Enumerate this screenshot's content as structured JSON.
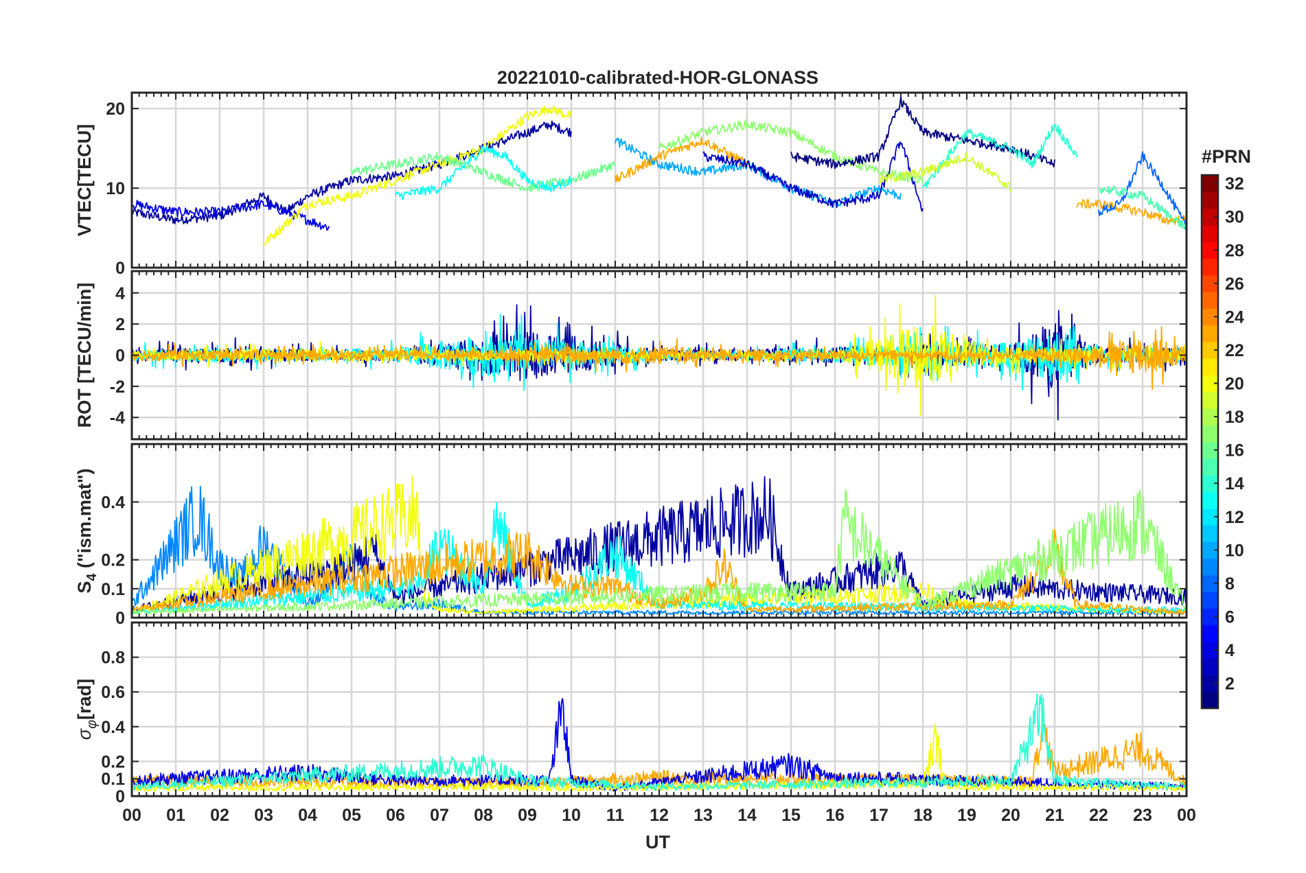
{
  "chart_data": {
    "type": "line",
    "title": "20221010-calibrated-HOR-GLONASS",
    "xlabel": "UT",
    "x_ticks": [
      "00",
      "01",
      "02",
      "03",
      "04",
      "05",
      "06",
      "07",
      "08",
      "09",
      "10",
      "11",
      "12",
      "13",
      "14",
      "15",
      "16",
      "17",
      "18",
      "19",
      "20",
      "21",
      "22",
      "23",
      "00"
    ],
    "xlim": [
      0,
      24
    ],
    "colorbar": {
      "label": "#PRN",
      "range": [
        1,
        32
      ],
      "ticks": [
        "32",
        "30",
        "28",
        "26",
        "24",
        "22",
        "20",
        "18",
        "16",
        "14",
        "12",
        "10",
        "8",
        "6",
        "4",
        "2"
      ]
    },
    "panels": [
      {
        "name": "vtec",
        "ylabel": "VTEC[TECU]",
        "ylim": [
          0,
          22
        ],
        "y_ticks": [
          "20",
          "10",
          "0"
        ],
        "y_tick_values": [
          20,
          10,
          0
        ],
        "series": [
          {
            "prn": 2,
            "x": [
              0.0,
              1.0,
              2.0,
              3.0,
              3.5,
              4.0,
              5.0,
              6.0,
              7.0,
              8.0,
              8.5,
              9.0,
              9.5,
              10.0
            ],
            "y": [
              7,
              6,
              6.5,
              9,
              7,
              9,
              11,
              11.5,
              13,
              15,
              16,
              17,
              18,
              17
            ]
          },
          {
            "prn": 4,
            "x": [
              0.0,
              1.0,
              2.0,
              3.0,
              4.0,
              4.5
            ],
            "y": [
              8,
              7,
              7,
              8,
              6,
              5
            ]
          },
          {
            "prn": 20,
            "x": [
              3.0,
              4.0,
              5.0,
              6.0,
              7.0,
              8.0,
              9.0,
              9.5,
              10.0
            ],
            "y": [
              3,
              8,
              9,
              11,
              13,
              15,
              19,
              20,
              19
            ]
          },
          {
            "prn": 16,
            "x": [
              5.0,
              6.0,
              7.0,
              8.0,
              9.0,
              10.0,
              11.0
            ],
            "y": [
              12,
              13,
              14,
              12,
              10,
              11,
              13
            ]
          },
          {
            "prn": 13,
            "x": [
              6.0,
              7.0,
              8.0,
              8.5,
              9.0,
              9.5,
              10.0
            ],
            "y": [
              9,
              10,
              15,
              14,
              11,
              10,
              11
            ]
          },
          {
            "prn": 10,
            "x": [
              11.0,
              12.0,
              13.0,
              14.0,
              15.0,
              16.0,
              17.0,
              17.5
            ],
            "y": [
              16,
              13,
              12,
              13,
              10,
              8,
              10,
              9
            ]
          },
          {
            "prn": 23,
            "x": [
              11.0,
              12.0,
              13.0,
              14.0
            ],
            "y": [
              11,
              14,
              16,
              13
            ]
          },
          {
            "prn": 17,
            "x": [
              12.0,
              13.0,
              14.0,
              15.0,
              16.0,
              17.0,
              18.0
            ],
            "y": [
              15,
              17,
              18,
              17,
              14,
              12,
              11
            ]
          },
          {
            "prn": 3,
            "x": [
              13.0,
              14.0,
              15.0,
              16.0,
              17.0,
              17.5,
              18.0
            ],
            "y": [
              14,
              13,
              10,
              8,
              9,
              16,
              7
            ]
          },
          {
            "prn": 1,
            "x": [
              15.0,
              16.0,
              17.0,
              17.5,
              18.0,
              19.0,
              20.0,
              21.0
            ],
            "y": [
              14,
              13,
              14,
              21,
              17,
              16,
              15,
              13
            ]
          },
          {
            "prn": 14,
            "x": [
              18.0,
              19.0,
              20.0,
              20.5,
              21.0,
              21.5
            ],
            "y": [
              10,
              17,
              15,
              13,
              18,
              14
            ]
          },
          {
            "prn": 19,
            "x": [
              17.0,
              18.0,
              19.0,
              20.0
            ],
            "y": [
              11,
              12,
              14,
              10
            ]
          },
          {
            "prn": 23,
            "x": [
              21.5,
              22.0,
              23.0,
              23.5,
              24.0
            ],
            "y": [
              8,
              8,
              7,
              6,
              6
            ]
          },
          {
            "prn": 8,
            "x": [
              22.0,
              22.5,
              23.0,
              23.5,
              24.0
            ],
            "y": [
              7,
              8,
              14,
              10,
              5
            ]
          },
          {
            "prn": 15,
            "x": [
              22.0,
              23.0,
              24.0
            ],
            "y": [
              10,
              9,
              5
            ]
          }
        ]
      },
      {
        "name": "rot",
        "ylabel": "ROT [TECU/min]",
        "ylim": [
          -5.4,
          5.4
        ],
        "y_ticks": [
          "4",
          "2",
          "0",
          "-2",
          "-4"
        ],
        "y_tick_values": [
          4,
          2,
          0,
          -2,
          -4
        ],
        "series": [
          {
            "prn": 2,
            "x": [
              0,
              2,
              4,
              6,
              8,
              9,
              10,
              12,
              14,
              16,
              18,
              20,
              21,
              22,
              24
            ],
            "amplitude": [
              0.8,
              1.2,
              0.8,
              0.8,
              2.5,
              3.5,
              2.5,
              0.8,
              0.8,
              1.2,
              1.5,
              1.5,
              5.0,
              1.2,
              1.0
            ]
          },
          {
            "prn": 13,
            "x": [
              0,
              2,
              4,
              6,
              8,
              9,
              10,
              12,
              14,
              16,
              18,
              20,
              21,
              22,
              24
            ],
            "amplitude": [
              0.8,
              1.0,
              0.8,
              1.0,
              3.0,
              2.5,
              2.0,
              0.6,
              0.6,
              1.0,
              2.0,
              2.0,
              4.0,
              1.0,
              1.5
            ]
          },
          {
            "prn": 20,
            "x": [
              0,
              4,
              6,
              8,
              10,
              12,
              16,
              18,
              18.5,
              19,
              20,
              24
            ],
            "amplitude": [
              0.6,
              1.0,
              0.7,
              0.8,
              0.7,
              0.5,
              0.5,
              4.5,
              3.5,
              2.0,
              1.2,
              0.8
            ]
          },
          {
            "prn": 23,
            "x": [
              0,
              4,
              8,
              10,
              12,
              14,
              20,
              22,
              23,
              24
            ],
            "amplitude": [
              0.8,
              0.7,
              0.6,
              1.2,
              1.2,
              0.8,
              0.6,
              1.2,
              3.0,
              1.2
            ]
          }
        ]
      },
      {
        "name": "s4",
        "ylabel": "S4 (\"ism.mat\")",
        "ylabel_sub": "4",
        "ylim": [
          0,
          0.6
        ],
        "y_ticks": [
          "0.4",
          "0.2",
          "0.1",
          "0"
        ],
        "y_tick_values": [
          0.4,
          0.2,
          0.1,
          0
        ],
        "series": [
          {
            "prn": 9,
            "x": [
              0,
              1.5,
              2.0,
              2.5,
              3.0,
              4.0,
              4.5,
              5.0,
              5.5,
              6.0,
              7.0,
              8.0,
              24
            ],
            "y": [
              0.05,
              0.4,
              0.2,
              0.15,
              0.28,
              0.05,
              0.12,
              0.22,
              0.08,
              0.04,
              0.05,
              0.02,
              0.02
            ]
          },
          {
            "prn": 2,
            "x": [
              0,
              5.0,
              5.5,
              6.0,
              14.5,
              15.0,
              17.5,
              18.0,
              20.0,
              24.0
            ],
            "y": [
              0.03,
              0.2,
              0.26,
              0.08,
              0.4,
              0.1,
              0.2,
              0.05,
              0.12,
              0.08
            ]
          },
          {
            "prn": 20,
            "x": [
              0,
              6.5,
              6.6,
              7.0,
              8.0,
              18.0,
              19.0,
              24.0
            ],
            "y": [
              0.02,
              0.4,
              0.1,
              0.03,
              0.02,
              0.1,
              0.05,
              0.02
            ]
          },
          {
            "prn": 13,
            "x": [
              0,
              6.5,
              7.0,
              8.0,
              8.3,
              9.0,
              10.0,
              11.0,
              12.0,
              24.0
            ],
            "y": [
              0.02,
              0.12,
              0.28,
              0.12,
              0.38,
              0.05,
              0.1,
              0.25,
              0.05,
              0.03
            ]
          },
          {
            "prn": 23,
            "x": [
              0,
              9.0,
              10.0,
              11.0,
              12.0,
              13.0,
              13.5,
              14.0,
              20.0,
              21.0,
              21.5,
              24.0
            ],
            "y": [
              0.03,
              0.25,
              0.12,
              0.12,
              0.05,
              0.1,
              0.2,
              0.03,
              0.05,
              0.25,
              0.05,
              0.02
            ]
          },
          {
            "prn": 17,
            "x": [
              0,
              14.0,
              15.0,
              16.0,
              16.2,
              18.0,
              23.0,
              24.0
            ],
            "y": [
              0.02,
              0.1,
              0.1,
              0.1,
              0.37,
              0.05,
              0.37,
              0.03
            ]
          }
        ]
      },
      {
        "name": "sigma",
        "ylabel": "σφ[rad]",
        "ylim": [
          0,
          1.0
        ],
        "y_ticks": [
          "0.8",
          "0.6",
          "0.4",
          "0.2",
          "0.1",
          "0"
        ],
        "y_tick_values": [
          0.8,
          0.6,
          0.4,
          0.2,
          0.1,
          0
        ],
        "series": [
          {
            "prn": 23,
            "x": [
              0,
              9,
              12,
              18,
              18.3,
              18.5,
              19,
              20.5,
              20.7,
              21,
              23,
              24
            ],
            "y": [
              0.1,
              0.08,
              0.12,
              0.1,
              0.1,
              0.1,
              0.1,
              0.1,
              0.47,
              0.15,
              0.3,
              0.08
            ]
          },
          {
            "prn": 4,
            "x": [
              0,
              4,
              6,
              9.5,
              9.8,
              10,
              11,
              15,
              16,
              24
            ],
            "y": [
              0.1,
              0.15,
              0.1,
              0.1,
              0.57,
              0.1,
              0.05,
              0.2,
              0.12,
              0.06
            ]
          },
          {
            "prn": 20,
            "x": [
              0,
              8,
              10,
              18,
              18.3,
              18.5,
              19,
              24
            ],
            "y": [
              0.05,
              0.06,
              0.05,
              0.08,
              0.37,
              0.08,
              0.06,
              0.05
            ]
          },
          {
            "prn": 14,
            "x": [
              0,
              8,
              9,
              12,
              20,
              20.7,
              21,
              24
            ],
            "y": [
              0.06,
              0.2,
              0.1,
              0.06,
              0.1,
              0.54,
              0.1,
              0.06
            ]
          }
        ]
      }
    ]
  }
}
